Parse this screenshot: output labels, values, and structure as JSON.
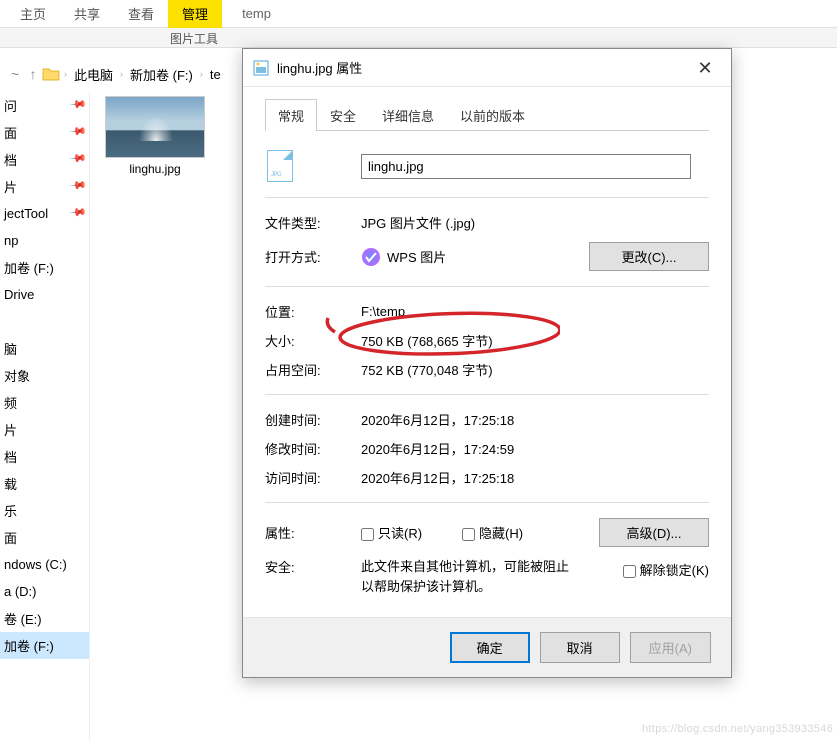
{
  "explorer": {
    "ribbon_tabs": {
      "home": "主页",
      "share": "共享",
      "view": "查看",
      "pic_tools": "图片工具",
      "pic_tools_sub": "管理"
    },
    "breadcrumb_path_label": "temp",
    "nav_up": "↑",
    "breadcrumb": {
      "pc": "此电脑",
      "drive": "新加卷 (F:)",
      "folder": "te"
    },
    "sidebar_items": [
      {
        "label": "问"
      },
      {
        "label": "面"
      },
      {
        "label": "档"
      },
      {
        "label": "片"
      },
      {
        "label": "jectTool"
      },
      {
        "label": "np"
      },
      {
        "label": "加卷 (F:)"
      },
      {
        "label": "Drive"
      },
      {
        "label": ""
      },
      {
        "label": "脑"
      },
      {
        "label": "对象"
      },
      {
        "label": "频"
      },
      {
        "label": "片"
      },
      {
        "label": "档"
      },
      {
        "label": "载"
      },
      {
        "label": "乐"
      },
      {
        "label": "面"
      },
      {
        "label": "ndows (C:)"
      },
      {
        "label": "a (D:)"
      },
      {
        "label": "卷 (E:)"
      },
      {
        "label": "加卷 (F:)",
        "selected": true
      }
    ],
    "thumbnail_caption": "linghu.jpg"
  },
  "dialog": {
    "title": "linghu.jpg 属性",
    "tabs": {
      "general": "常规",
      "security": "安全",
      "details": "详细信息",
      "prev": "以前的版本"
    },
    "filename": "linghu.jpg",
    "labels": {
      "filetype": "文件类型:",
      "open_with": "打开方式:",
      "location": "位置:",
      "size": "大小:",
      "size_on_disk": "占用空间:",
      "created": "创建时间:",
      "modified": "修改时间:",
      "accessed": "访问时间:",
      "attributes": "属性:",
      "security": "安全:"
    },
    "values": {
      "filetype": "JPG 图片文件 (.jpg)",
      "open_with": "WPS 图片",
      "location": "F:\\temp",
      "size": "750 KB (768,665 字节)",
      "size_on_disk": "752 KB (770,048 字节)",
      "created": "2020年6月12日，17:25:18",
      "modified": "2020年6月12日，17:24:59",
      "accessed": "2020年6月12日，17:25:18",
      "security_text": "此文件来自其他计算机，可能被阻止以帮助保护该计算机。"
    },
    "buttons": {
      "change": "更改(C)...",
      "advanced": "高级(D)...",
      "readonly": "只读(R)",
      "hidden": "隐藏(H)",
      "unblock": "解除锁定(K)",
      "ok": "确定",
      "cancel": "取消",
      "apply": "应用(A)"
    }
  },
  "watermark": "https://blog.csdn.net/yang353933546"
}
